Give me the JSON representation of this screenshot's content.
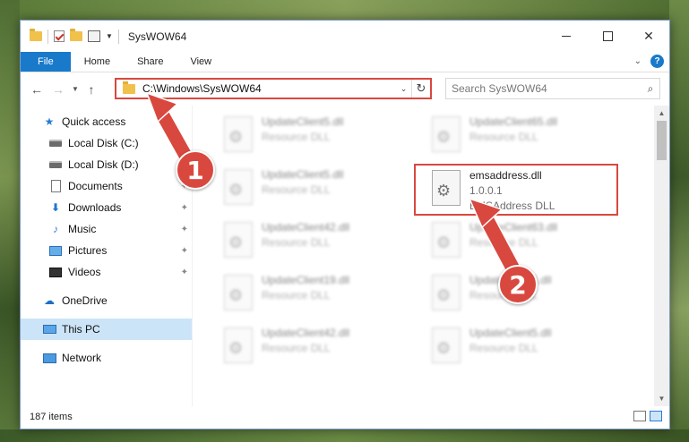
{
  "window": {
    "title": "SysWOW64"
  },
  "ribbon": {
    "tabs": [
      "File",
      "Home",
      "Share",
      "View"
    ]
  },
  "address": {
    "path": "C:\\Windows\\SysWOW64",
    "search_placeholder": "Search SysWOW64"
  },
  "sidebar": {
    "items": [
      {
        "label": "Quick access",
        "icon": "star-icon"
      },
      {
        "label": "Local Disk (C:)",
        "icon": "disk-icon"
      },
      {
        "label": "Local Disk (D:)",
        "icon": "disk-icon"
      },
      {
        "label": "Documents",
        "icon": "document-icon"
      },
      {
        "label": "Downloads",
        "icon": "download-icon"
      },
      {
        "label": "Music",
        "icon": "music-icon"
      },
      {
        "label": "Pictures",
        "icon": "pictures-icon"
      },
      {
        "label": "Videos",
        "icon": "videos-icon"
      },
      {
        "label": "OneDrive",
        "icon": "cloud-icon"
      },
      {
        "label": "This PC",
        "icon": "computer-icon"
      },
      {
        "label": "Network",
        "icon": "network-icon"
      }
    ],
    "selected": "This PC"
  },
  "files": [
    {
      "name": "UpdateClient5.dll",
      "type": "Resource DLL"
    },
    {
      "name": "UpdateClient65.dll",
      "type": "Resource DLL"
    },
    {
      "name": "UpdateClient5.dll",
      "type": "Resource DLL"
    },
    {
      "name": "emsaddress.dll",
      "version": "1.0.0.1",
      "type": "EMSAddress DLL"
    },
    {
      "name": "UpdateClient42.dll",
      "type": "Resource DLL"
    },
    {
      "name": "UpdateClient63.dll",
      "type": "Resource DLL"
    },
    {
      "name": "UpdateClient19.dll",
      "type": "Resource DLL"
    },
    {
      "name": "UpdateClient5.dll",
      "type": "Resource DLL"
    },
    {
      "name": "UpdateClient42.dll",
      "type": "Resource DLL"
    },
    {
      "name": "UpdateClient5.dll",
      "type": "Resource DLL"
    }
  ],
  "status": {
    "item_count": "187 items"
  },
  "callouts": {
    "one": "1",
    "two": "2",
    "color": "#d9483e"
  }
}
